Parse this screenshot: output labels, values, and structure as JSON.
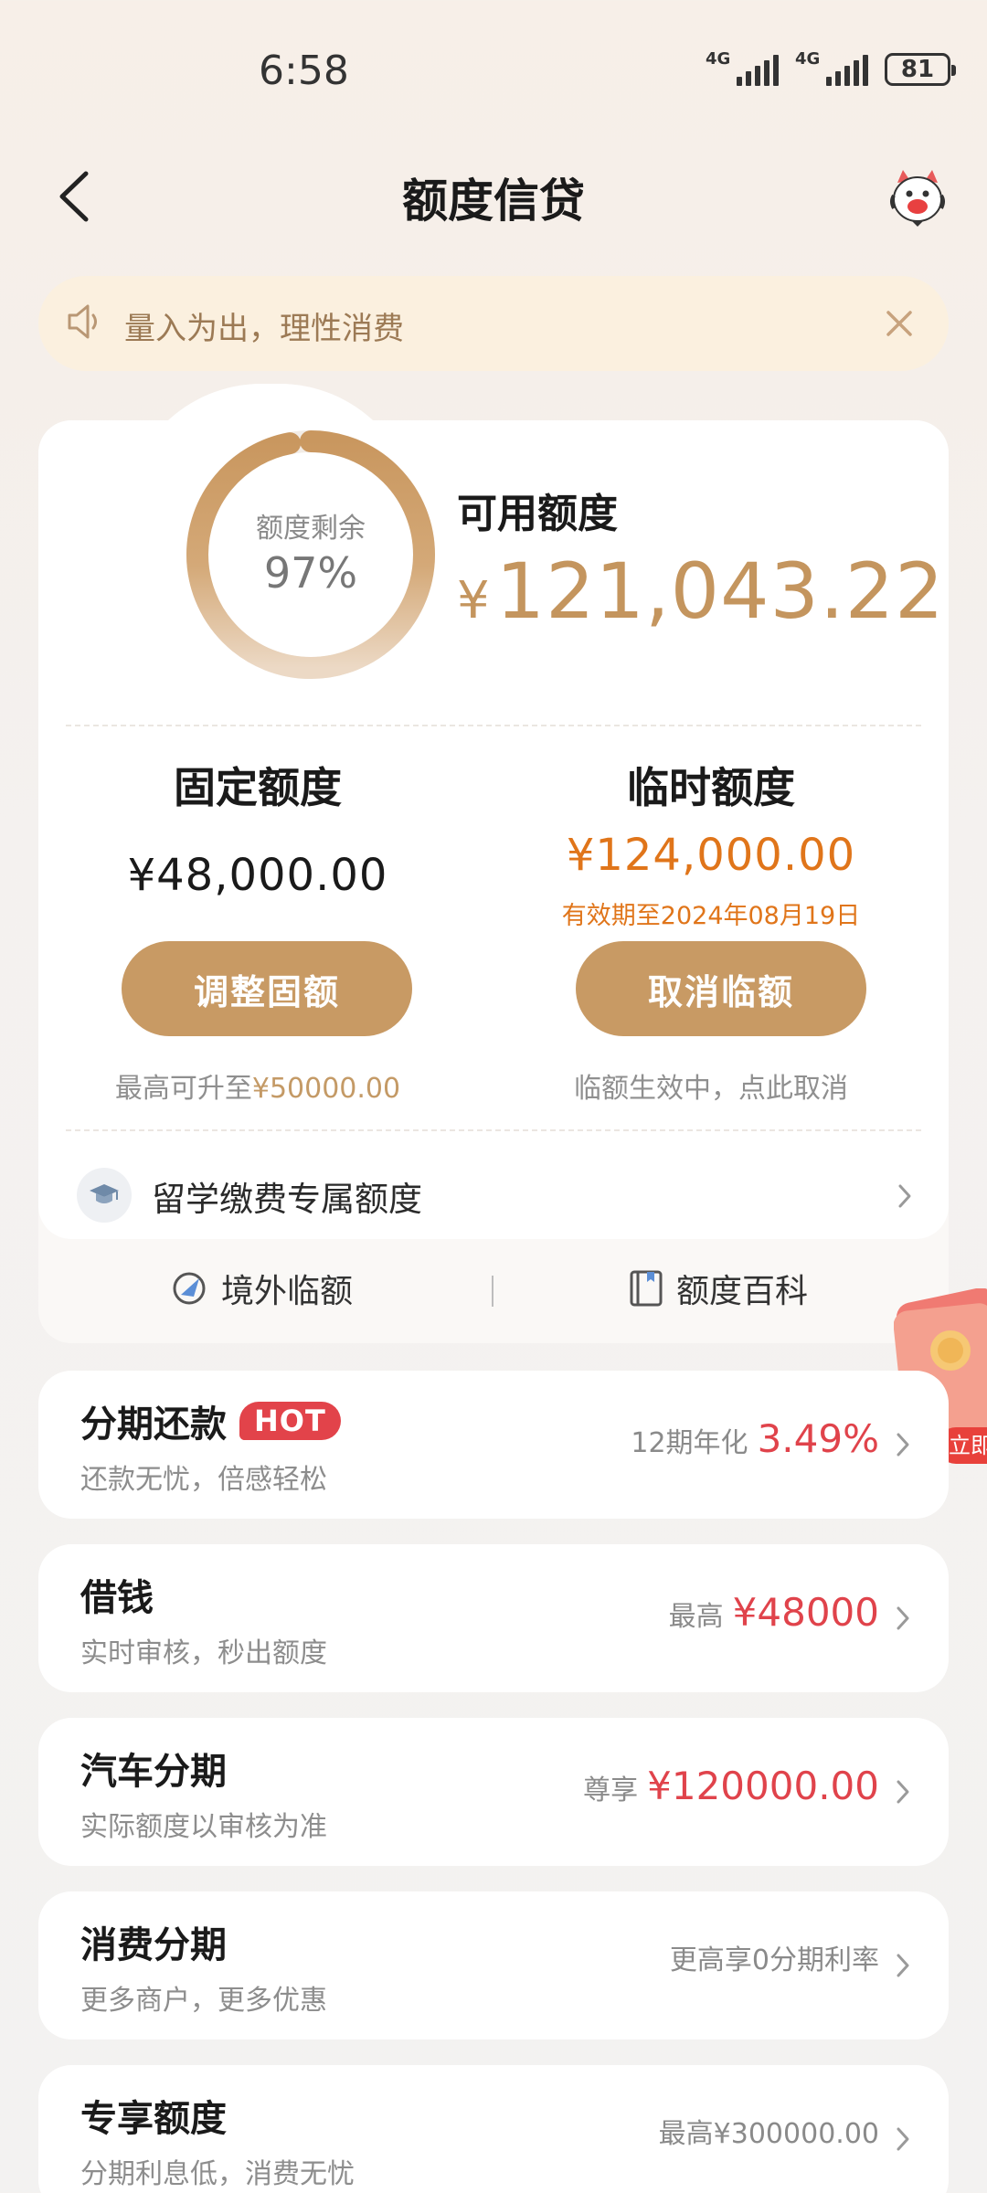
{
  "status_bar": {
    "time": "6:58",
    "signal1": "4G",
    "signal2": "4G",
    "battery": "81"
  },
  "header": {
    "title": "额度信贷"
  },
  "notice": {
    "text": "量入为出，理性消费"
  },
  "credit": {
    "ring_label": "额度剩余",
    "ring_percent": "97%",
    "ring_fraction": 0.97,
    "available_label": "可用额度",
    "available_currency": "¥",
    "available_amount": "121,043.22",
    "fixed": {
      "title": "固定额度",
      "amount": "¥48,000.00",
      "button": "调整固额",
      "hint_prefix": "最高可升至",
      "hint_value": "¥50000.00"
    },
    "temp": {
      "title": "临时额度",
      "amount": "¥124,000.00",
      "expiry": "有效期至2024年08月19日",
      "button": "取消临额",
      "hint": "临额生效中，点此取消"
    },
    "study_row": "留学缴费专属额度"
  },
  "tools": {
    "overseas": "境外临额",
    "wiki": "额度百科"
  },
  "float_cta": "立即",
  "products": [
    {
      "title": "分期还款",
      "badge": "HOT",
      "subtitle": "还款无忧，倍感轻松",
      "right_prefix": "12期年化",
      "right_value": "3.49%"
    },
    {
      "title": "借钱",
      "subtitle": "实时审核，秒出额度",
      "right_prefix": "最高",
      "right_value": "¥48000"
    },
    {
      "title": "汽车分期",
      "subtitle": "实际额度以审核为准",
      "right_prefix": "尊享",
      "right_value": "¥120000.00"
    },
    {
      "title": "消费分期",
      "subtitle": "更多商户，更多优惠",
      "right_prefix": "更高享0分期利率",
      "right_value": ""
    },
    {
      "title": "专享额度",
      "subtitle": "分期利息低，消费无忧",
      "right_prefix": "最高¥300000.00",
      "right_value": ""
    }
  ],
  "colors": {
    "gold": "#c89a64",
    "orange": "#e0751a",
    "red": "#e0434b"
  }
}
